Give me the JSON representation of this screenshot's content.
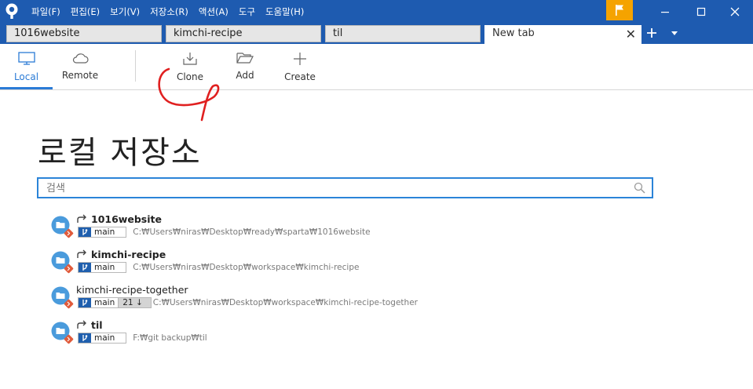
{
  "menu": {
    "items": [
      "파일(F)",
      "편집(E)",
      "보기(V)",
      "저장소(R)",
      "액션(A)",
      "도구",
      "도움말(H)"
    ]
  },
  "tabs": [
    {
      "label": "1016website",
      "active": false
    },
    {
      "label": "kimchi-recipe",
      "active": false
    },
    {
      "label": "til",
      "active": false
    },
    {
      "label": "New tab",
      "active": true
    }
  ],
  "tab_controls": {
    "close": "✕",
    "add": "+"
  },
  "toolbar": {
    "local_label": "Local",
    "remote_label": "Remote",
    "clone_label": "Clone",
    "add_label": "Add",
    "create_label": "Create"
  },
  "page": {
    "title": "로컬 저장소"
  },
  "search": {
    "placeholder": "검색",
    "value": ""
  },
  "repos": [
    {
      "name": "1016website",
      "bold": true,
      "tracked": true,
      "branch": "main",
      "behind": "",
      "path": "C:₩Users₩niras₩Desktop₩ready₩sparta₩1016website"
    },
    {
      "name": "kimchi-recipe",
      "bold": true,
      "tracked": true,
      "branch": "main",
      "behind": "",
      "path": "C:₩Users₩niras₩Desktop₩workspace₩kimchi-recipe"
    },
    {
      "name": "kimchi-recipe-together",
      "bold": false,
      "tracked": false,
      "branch": "main",
      "behind": "21 ↓",
      "path": "C:₩Users₩niras₩Desktop₩workspace₩kimchi-recipe-together"
    },
    {
      "name": "til",
      "bold": true,
      "tracked": true,
      "branch": "main",
      "behind": "",
      "path": "F:₩git backup₩til"
    }
  ],
  "colors": {
    "titlebar": "#1e5bb0",
    "accent": "#2b7bd6",
    "flag": "#f5a300",
    "annotation": "#e02020"
  }
}
